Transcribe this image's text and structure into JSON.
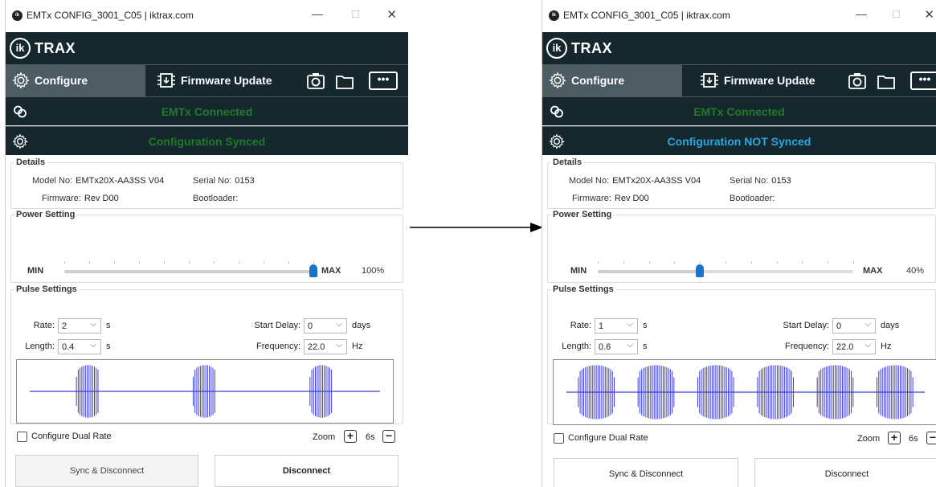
{
  "windows": [
    {
      "title": "EMTx CONFIG_3001_C05 | iktrax.com",
      "brand": "TRAX",
      "brand_mark": "ik",
      "nav": {
        "configure_label": "Configure",
        "firmware_label": "Firmware Update"
      },
      "connection_status": "EMTx Connected",
      "config_status": "Configuration Synced",
      "details": {
        "legend": "Details",
        "model_label": "Model No:",
        "model_value": "EMTx20X-AA3SS  V04",
        "serial_label": "Serial No:",
        "serial_value": "0153",
        "firmware_label": "Firmware:",
        "firmware_value": "Rev D00",
        "bootloader_label": "Bootloader:",
        "bootloader_value": ""
      },
      "power": {
        "legend": "Power Setting",
        "min_label": "MIN",
        "max_label": "MAX",
        "value_text": "100%",
        "level": 1.0
      },
      "pulse": {
        "legend": "Pulse Settings",
        "rate_label": "Rate:",
        "rate_value": "2",
        "rate_unit": "s",
        "length_label": "Length:",
        "length_value": "0.4",
        "length_unit": "s",
        "start_delay_label": "Start Delay:",
        "start_delay_value": "0",
        "start_delay_unit": "days",
        "frequency_label": "Frequency:",
        "frequency_value": "22.0",
        "frequency_unit": "Hz"
      },
      "dual_rate_label": "Configure Dual Rate",
      "zoom": {
        "label": "Zoom",
        "value": "6s"
      },
      "buttons": {
        "sync_disconnect": "Sync & Disconnect",
        "disconnect": "Disconnect"
      }
    },
    {
      "title": "EMTx CONFIG_3001_C05 | iktrax.com",
      "brand": "TRAX",
      "brand_mark": "ik",
      "nav": {
        "configure_label": "Configure",
        "firmware_label": "Firmware Update"
      },
      "connection_status": "EMTx Connected",
      "config_status": "Configuration NOT Synced",
      "details": {
        "legend": "Details",
        "model_label": "Model No:",
        "model_value": "EMTx20X-AA3SS  V04",
        "serial_label": "Serial No:",
        "serial_value": "0153",
        "firmware_label": "Firmware:",
        "firmware_value": "Rev D00",
        "bootloader_label": "Bootloader:",
        "bootloader_value": ""
      },
      "power": {
        "legend": "Power Setting",
        "min_label": "MIN",
        "max_label": "MAX",
        "value_text": "40%",
        "level": 0.4
      },
      "pulse": {
        "legend": "Pulse Settings",
        "rate_label": "Rate:",
        "rate_value": "1",
        "rate_unit": "s",
        "length_label": "Length:",
        "length_value": "0.6",
        "length_unit": "s",
        "start_delay_label": "Start Delay:",
        "start_delay_value": "0",
        "start_delay_unit": "days",
        "frequency_label": "Frequency:",
        "frequency_value": "22.0",
        "frequency_unit": "Hz"
      },
      "dual_rate_label": "Configure Dual Rate",
      "zoom": {
        "label": "Zoom",
        "value": "6s"
      },
      "buttons": {
        "sync_disconnect": "Sync & Disconnect",
        "disconnect": "Disconnect"
      }
    }
  ],
  "colors": {
    "dark_bar": "#16282e",
    "active_tab": "#4c5c62",
    "connected_text": "#1f7a2a",
    "synced_text": "#1f7a2a",
    "not_synced_text": "#29a8e0",
    "slider_thumb": "#1a73c9",
    "waveform": "#3d3dd6"
  }
}
